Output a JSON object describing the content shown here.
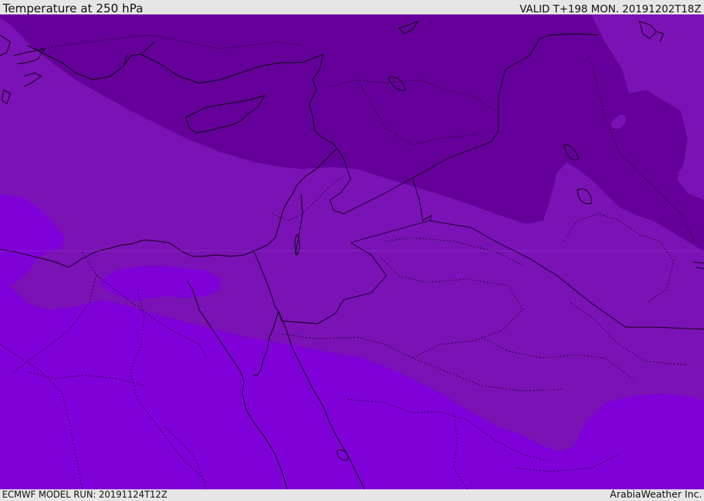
{
  "header": {
    "title": "Temperature at 250 hPa",
    "valid": "VALID T+198 MON. 20191202T18Z"
  },
  "footer": {
    "model_run": "ECMWF MODEL RUN: 20191124T12Z",
    "credit": "ArabiaWeather Inc."
  },
  "colors": {
    "band_coldest": "#640099",
    "band_cold": "#7a12b5",
    "band_mild": "#8000d9",
    "coastline": "#000000",
    "background": "#e6e6e6"
  }
}
